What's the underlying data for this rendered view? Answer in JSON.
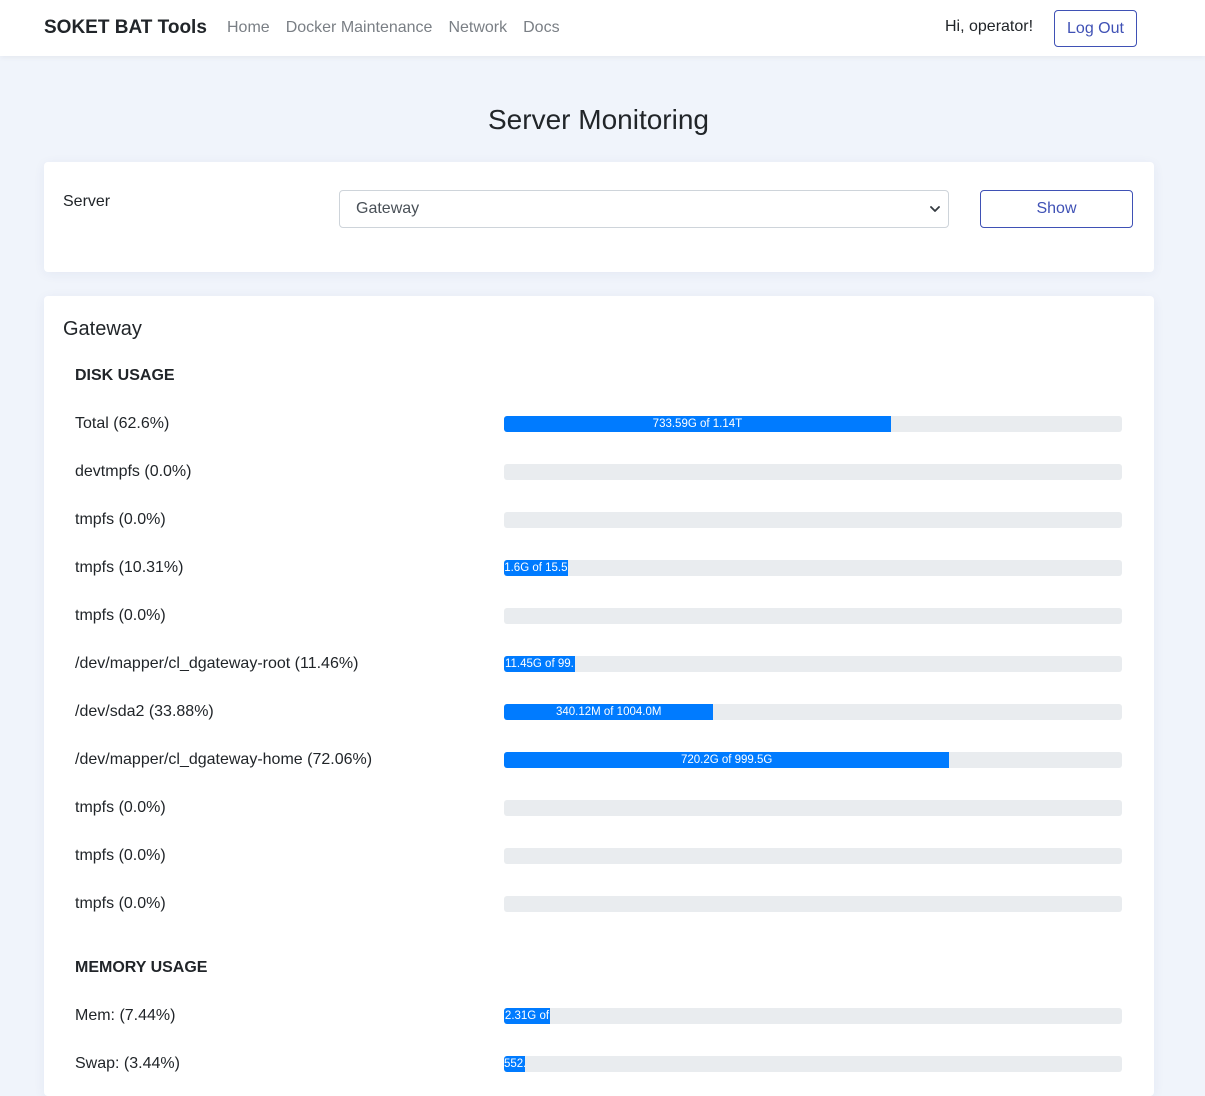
{
  "nav": {
    "brand": "SOKET BAT Tools",
    "links": [
      "Home",
      "Docker Maintenance",
      "Network",
      "Docs"
    ],
    "greeting": "Hi, operator!",
    "logout_label": "Log Out"
  },
  "page_title": "Server Monitoring",
  "server_form": {
    "label": "Server",
    "selected": "Gateway",
    "show_label": "Show"
  },
  "detail": {
    "server_name": "Gateway",
    "disk_title": "DISK USAGE",
    "disks": [
      {
        "label": "Total (62.6%)",
        "percent": 62.6,
        "bar_text": "733.59G of 1.14T"
      },
      {
        "label": "devtmpfs (0.0%)",
        "percent": 0.0,
        "bar_text": ""
      },
      {
        "label": "tmpfs (0.0%)",
        "percent": 0.0,
        "bar_text": ""
      },
      {
        "label": "tmpfs (10.31%)",
        "percent": 10.31,
        "bar_text": "1.6G of 15.5"
      },
      {
        "label": "tmpfs (0.0%)",
        "percent": 0.0,
        "bar_text": ""
      },
      {
        "label": "/dev/mapper/cl_dgateway-root (11.46%)",
        "percent": 11.46,
        "bar_text": "11.45G of 99."
      },
      {
        "label": "/dev/sda2 (33.88%)",
        "percent": 33.88,
        "bar_text": "340.12M of 1004.0M"
      },
      {
        "label": "/dev/mapper/cl_dgateway-home (72.06%)",
        "percent": 72.06,
        "bar_text": "720.2G of 999.5G"
      },
      {
        "label": "tmpfs (0.0%)",
        "percent": 0.0,
        "bar_text": ""
      },
      {
        "label": "tmpfs (0.0%)",
        "percent": 0.0,
        "bar_text": ""
      },
      {
        "label": "tmpfs (0.0%)",
        "percent": 0.0,
        "bar_text": ""
      }
    ],
    "memory_title": "MEMORY USAGE",
    "memory": [
      {
        "label": "Mem: (7.44%)",
        "percent": 7.44,
        "bar_text": "2.31G of"
      },
      {
        "label": "Swap: (3.44%)",
        "percent": 3.44,
        "bar_text": "552."
      }
    ]
  }
}
